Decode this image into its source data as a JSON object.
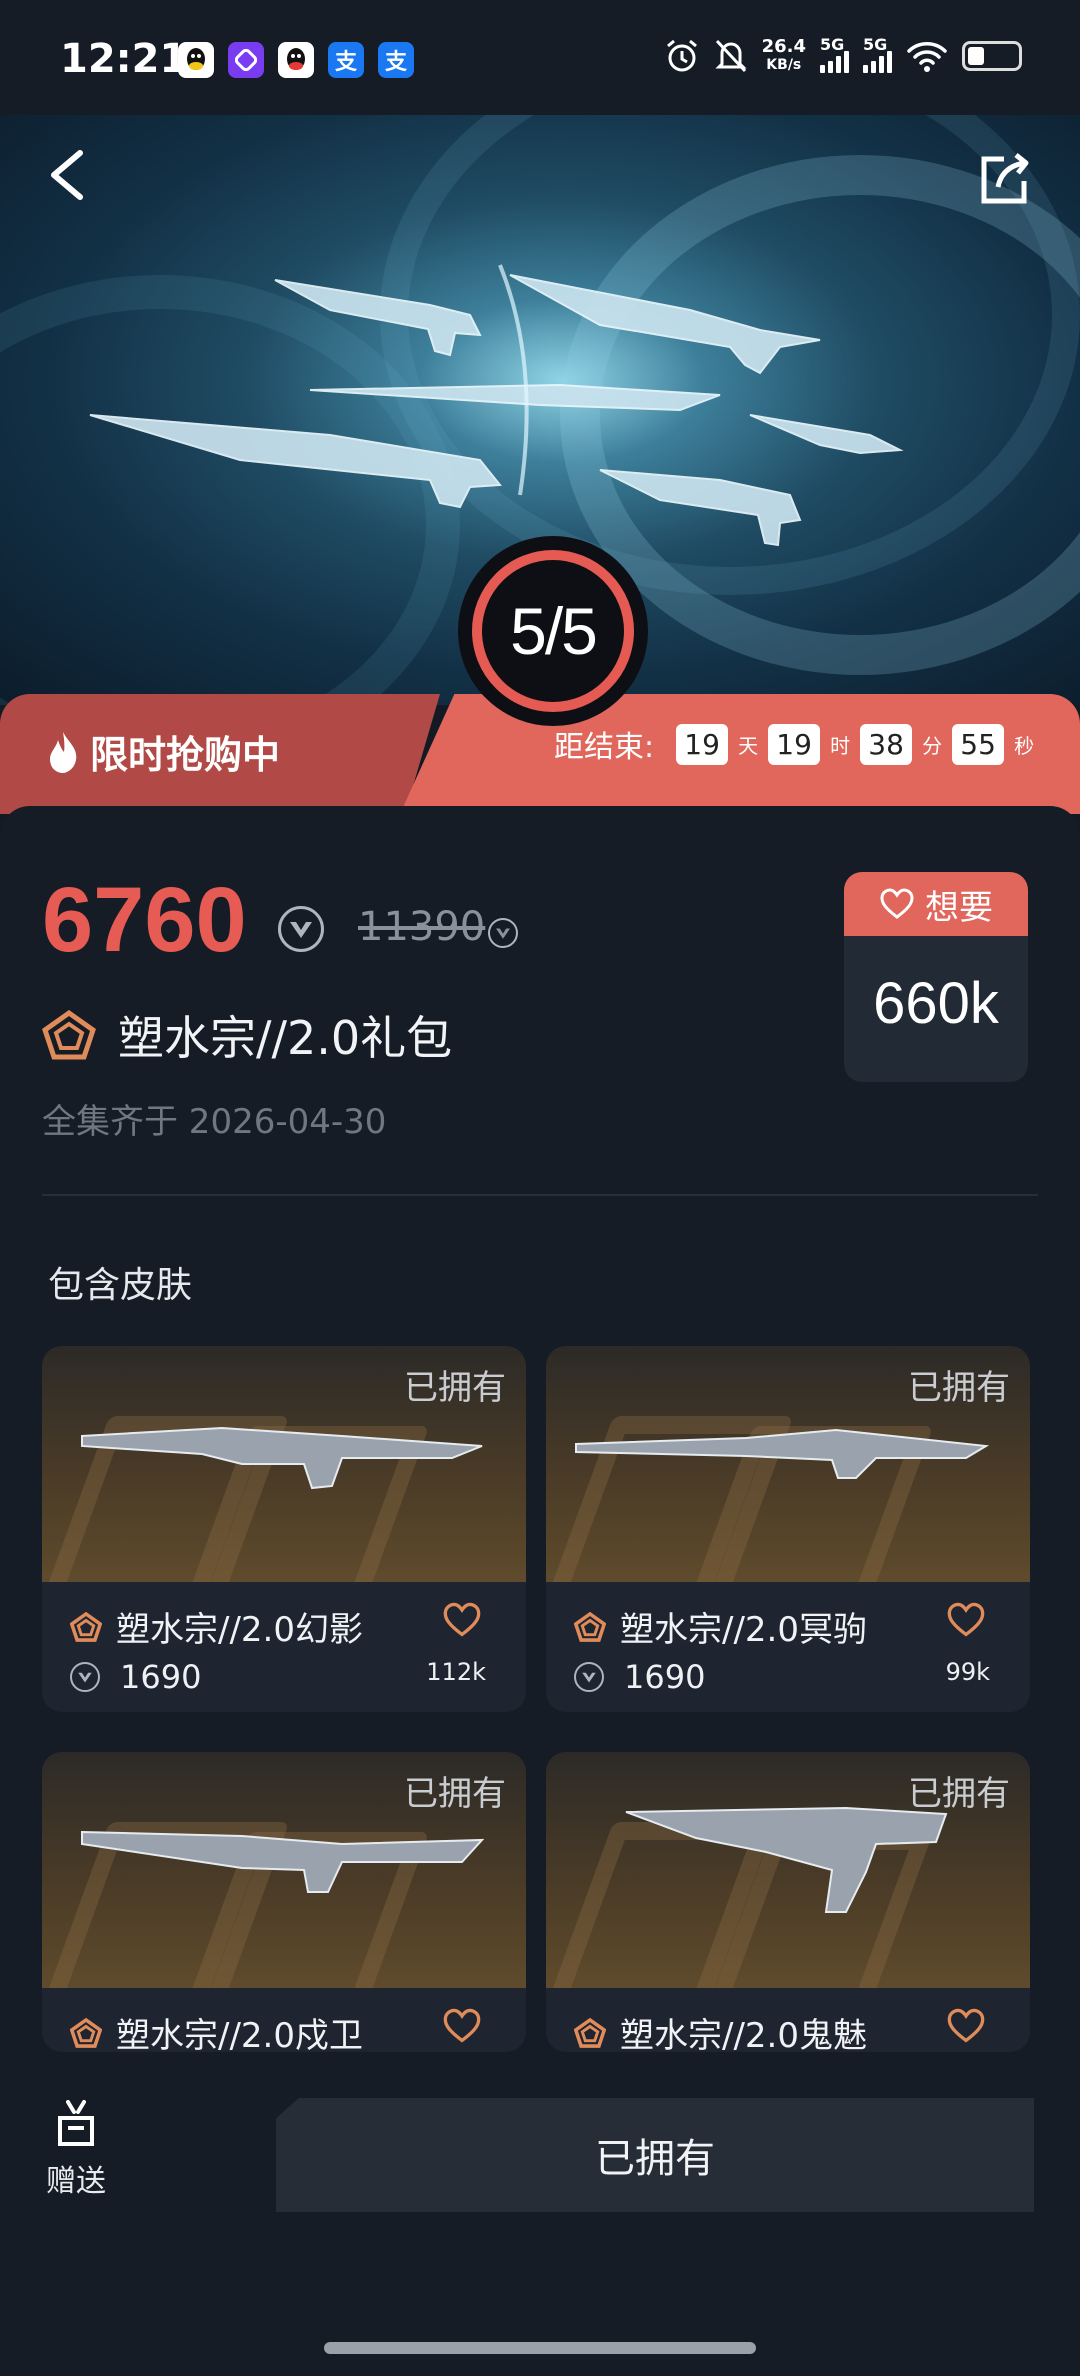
{
  "status_bar": {
    "time": "12:21",
    "net_speed_value": "26.4",
    "net_speed_unit": "KB/s",
    "signal1_label": "5G",
    "signal2_label": "5G",
    "notifications": [
      "qq-icon",
      "app-icon",
      "qq-icon",
      "alipay-icon",
      "alipay-icon"
    ],
    "notif_alipay_char": "支"
  },
  "hero": {
    "progress": "5/5",
    "icons": [
      "back-arrow-icon",
      "share-icon"
    ]
  },
  "sale": {
    "title": "限时抢购中",
    "ends_label": "距结束:",
    "days": "19",
    "days_unit": "天",
    "hours": "19",
    "hours_unit": "时",
    "minutes": "38",
    "minutes_unit": "分",
    "seconds": "55",
    "seconds_unit": "秒"
  },
  "bundle": {
    "price": "6760",
    "original_price": "11390",
    "name": "塑水宗//2.0礼包",
    "release": "全集齐于 2026-04-30",
    "want_label": "想要",
    "want_count": "660k"
  },
  "skins_section": {
    "title": "包含皮肤",
    "items": [
      {
        "name": "塑水宗//2.0幻影",
        "status": "已拥有",
        "price": "1690",
        "likes": "112k"
      },
      {
        "name": "塑水宗//2.0冥驹",
        "status": "已拥有",
        "price": "1690",
        "likes": "99k"
      },
      {
        "name": "塑水宗//2.0戍卫",
        "status": "已拥有"
      },
      {
        "name": "塑水宗//2.0鬼魅",
        "status": "已拥有"
      }
    ]
  },
  "bottom": {
    "gift_label": "赠送",
    "owned_button": "已拥有"
  },
  "colors": {
    "accent": "#e65b54",
    "sale_dark": "#b14a46",
    "sale_light": "#e1665c",
    "background": "#161c25"
  }
}
